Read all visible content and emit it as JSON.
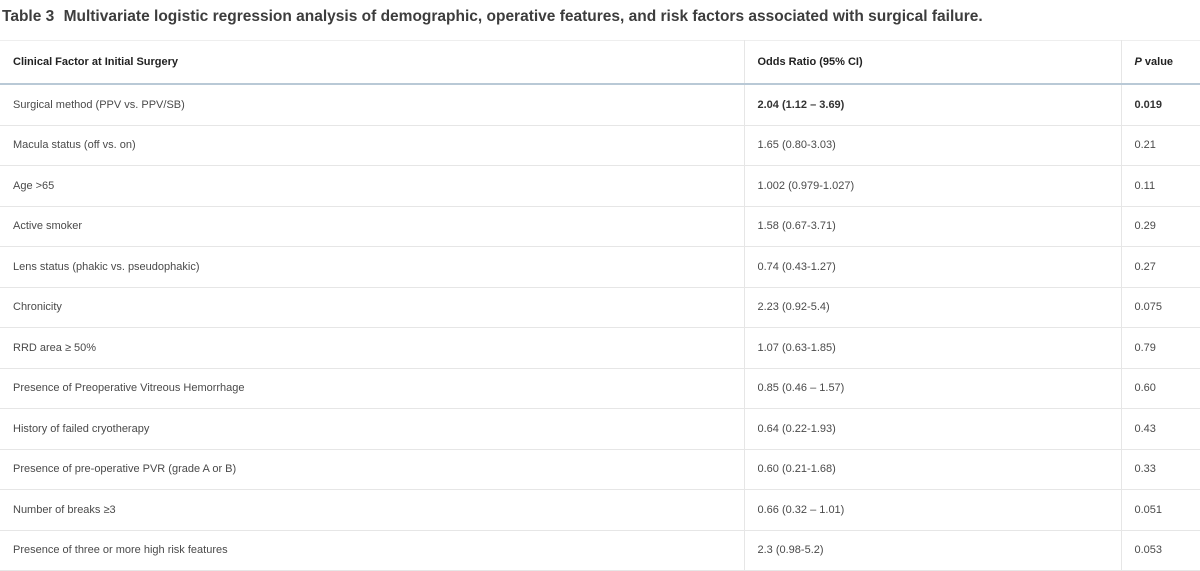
{
  "caption": {
    "label": "Table 3",
    "title": "Multivariate logistic regression analysis of demographic, operative features, and risk factors associated with surgical failure."
  },
  "table": {
    "headers": {
      "factor": "Clinical Factor at Initial Surgery",
      "odds_ratio": "Odds Ratio (95% CI)",
      "p_prefix": "P",
      "p_suffix": " value"
    },
    "rows": [
      {
        "factor": "Surgical method (PPV vs. PPV/SB)",
        "odds_ratio": "2.04 (1.12 – 3.69)",
        "p_value": "0.019",
        "bold": true
      },
      {
        "factor": "Macula status (off vs. on)",
        "odds_ratio": "1.65 (0.80-3.03)",
        "p_value": "0.21"
      },
      {
        "factor": "Age >65",
        "odds_ratio": "1.002 (0.979-1.027)",
        "p_value": "0.11"
      },
      {
        "factor": "Active smoker",
        "odds_ratio": "1.58 (0.67-3.71)",
        "p_value": "0.29"
      },
      {
        "factor": "Lens status (phakic vs. pseudophakic)",
        "odds_ratio": "0.74 (0.43-1.27)",
        "p_value": "0.27"
      },
      {
        "factor": "Chronicity",
        "odds_ratio": "2.23 (0.92-5.4)",
        "p_value": "0.075"
      },
      {
        "factor": "RRD area ≥ 50%",
        "odds_ratio": "1.07 (0.63-1.85)",
        "p_value": "0.79"
      },
      {
        "factor": "Presence of Preoperative Vitreous Hemorrhage",
        "odds_ratio": "0.85 (0.46 – 1.57)",
        "p_value": "0.60"
      },
      {
        "factor": "History of failed cryotherapy",
        "odds_ratio": "0.64 (0.22-1.93)",
        "p_value": "0.43"
      },
      {
        "factor": "Presence of pre-operative PVR (grade A or B)",
        "odds_ratio": "0.60 (0.21-1.68)",
        "p_value": "0.33"
      },
      {
        "factor": "Number of breaks ≥3",
        "odds_ratio": "0.66 (0.32 – 1.01)",
        "p_value": "0.051"
      },
      {
        "factor": "Presence of three or more high risk features",
        "odds_ratio": "2.3 (0.98-5.2)",
        "p_value": "0.053"
      }
    ]
  }
}
